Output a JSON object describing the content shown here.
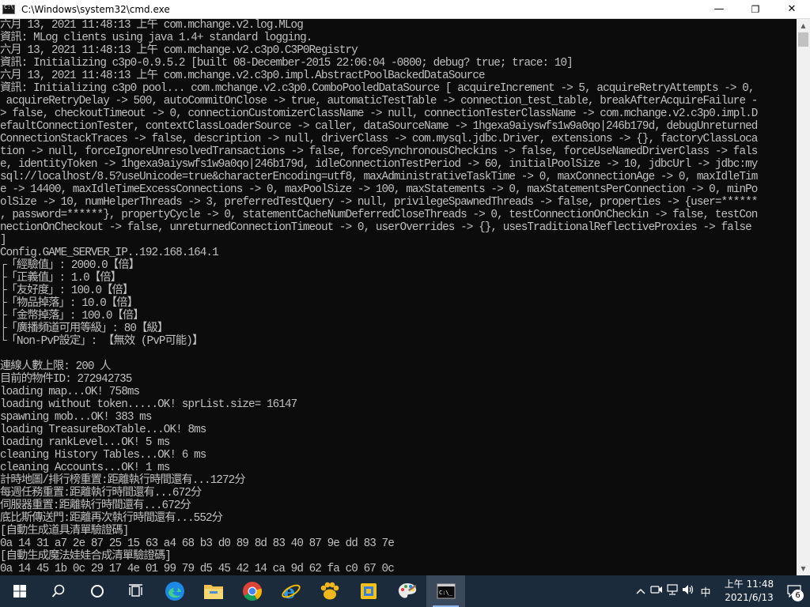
{
  "window": {
    "title": "C:\\Windows\\system32\\cmd.exe",
    "minimize": "—",
    "maximize": "❐",
    "close": "✕"
  },
  "console": {
    "lines": [
      "六月 13, 2021 11:48:13 上午 com.mchange.v2.log.MLog",
      "資訊: MLog clients using java 1.4+ standard logging.",
      "六月 13, 2021 11:48:13 上午 com.mchange.v2.c3p0.C3P0Registry",
      "資訊: Initializing c3p0-0.9.5.2 [built 08-December-2015 22:06:04 -0800; debug? true; trace: 10]",
      "六月 13, 2021 11:48:13 上午 com.mchange.v2.c3p0.impl.AbstractPoolBackedDataSource",
      "資訊: Initializing c3p0 pool... com.mchange.v2.c3p0.ComboPooledDataSource [ acquireIncrement -> 5, acquireRetryAttempts -> 0,",
      " acquireRetryDelay -> 500, autoCommitOnClose -> true, automaticTestTable -> connection_test_table, breakAfterAcquireFailure -",
      "> false, checkoutTimeout -> 0, connectionCustomizerClassName -> null, connectionTesterClassName -> com.mchange.v2.c3p0.impl.D",
      "efaultConnectionTester, contextClassLoaderSource -> caller, dataSourceName -> 1hgexa9aiyswfs1w9a0qo|246b179d, debugUnreturned",
      "ConnectionStackTraces -> false, description -> null, driverClass -> com.mysql.jdbc.Driver, extensions -> {}, factoryClassLoca",
      "tion -> null, forceIgnoreUnresolvedTransactions -> false, forceSynchronousCheckins -> false, forceUseNamedDriverClass -> fals",
      "e, identityToken -> 1hgexa9aiyswfs1w9a0qo|246b179d, idleConnectionTestPeriod -> 60, initialPoolSize -> 10, jdbcUrl -> jdbc:my",
      "sql://localhost/8.5?useUnicode=true&characterEncoding=utf8, maxAdministrativeTaskTime -> 0, maxConnectionAge -> 0, maxIdleTim",
      "e -> 14400, maxIdleTimeExcessConnections -> 0, maxPoolSize -> 100, maxStatements -> 0, maxStatementsPerConnection -> 0, minPo",
      "olSize -> 10, numHelperThreads -> 3, preferredTestQuery -> null, privilegeSpawnedThreads -> false, properties -> {user=******",
      ", password=******}, propertyCycle -> 0, statementCacheNumDeferredCloseThreads -> 0, testConnectionOnCheckin -> false, testCon",
      "nectionOnCheckout -> false, unreturnedConnectionTimeout -> 0, userOverrides -> {}, usesTraditionalReflectiveProxies -> false",
      "]",
      "Config.GAME_SERVER_IP..192.168.164.1",
      "┌「經驗值」: 2000.0【倍】",
      "├「正義值」: 1.0【倍】",
      "├「友好度」: 100.0【倍】",
      "├「物品掉落」: 10.0【倍】",
      "├「金幣掉落」: 100.0【倍】",
      "├「廣播頻道可用等級」: 80【級】",
      "└「Non-PvP設定」: 【無效 (PvP可能)】",
      "",
      "連線人數上限: 200 人",
      "目前的物件ID: 272942735",
      "loading map...OK! 758ms",
      "loading without token.....OK! sprList.size= 16147",
      "spawning mob...OK! 383 ms",
      "loading TreasureBoxTable...OK! 8ms",
      "loading rankLevel...OK! 5 ms",
      "cleaning History Tables...OK! 6 ms",
      "cleaning Accounts...OK! 1 ms",
      "計時地圖/排行榜重置:距離執行時間還有...1272分",
      "每週任務重置:距離執行時間還有...672分",
      "伺服器重置:距離執行時間還有...672分",
      "底比斯傳送門:距離再次執行時間還有...552分",
      "[自動生成道具清單驗證碼]",
      "0a 14 31 a7 2e 87 25 15 63 a4 68 b3 d0 89 8d 83 40 87 9e dd 83 7e",
      "[自動生成魔法娃娃合成清單驗證碼]",
      "0a 14 45 1b 0c 29 17 4e 01 99 79 d5 45 42 14 ca 9d 62 fa c0 67 0c"
    ]
  },
  "scrollbar": {
    "up_arrow": "▲",
    "down_arrow": "▼"
  },
  "taskbar": {
    "apps": [
      {
        "name": "start",
        "icon": "windows-logo"
      },
      {
        "name": "search",
        "icon": "search"
      },
      {
        "name": "cortana",
        "icon": "circle"
      },
      {
        "name": "task-view",
        "icon": "task-view"
      },
      {
        "name": "edge",
        "icon": "edge"
      },
      {
        "name": "file-explorer",
        "icon": "folder"
      },
      {
        "name": "chrome",
        "icon": "chrome"
      },
      {
        "name": "internet-explorer",
        "icon": "ie"
      },
      {
        "name": "app-paw",
        "icon": "paw"
      },
      {
        "name": "app-yellow-box",
        "icon": "box"
      },
      {
        "name": "paint",
        "icon": "palette"
      },
      {
        "name": "cmd",
        "icon": "terminal"
      }
    ],
    "tray": {
      "chevron": "^",
      "ime": "中",
      "time": "上午 11:48",
      "date": "2021/6/13",
      "notification_count": "6"
    }
  }
}
